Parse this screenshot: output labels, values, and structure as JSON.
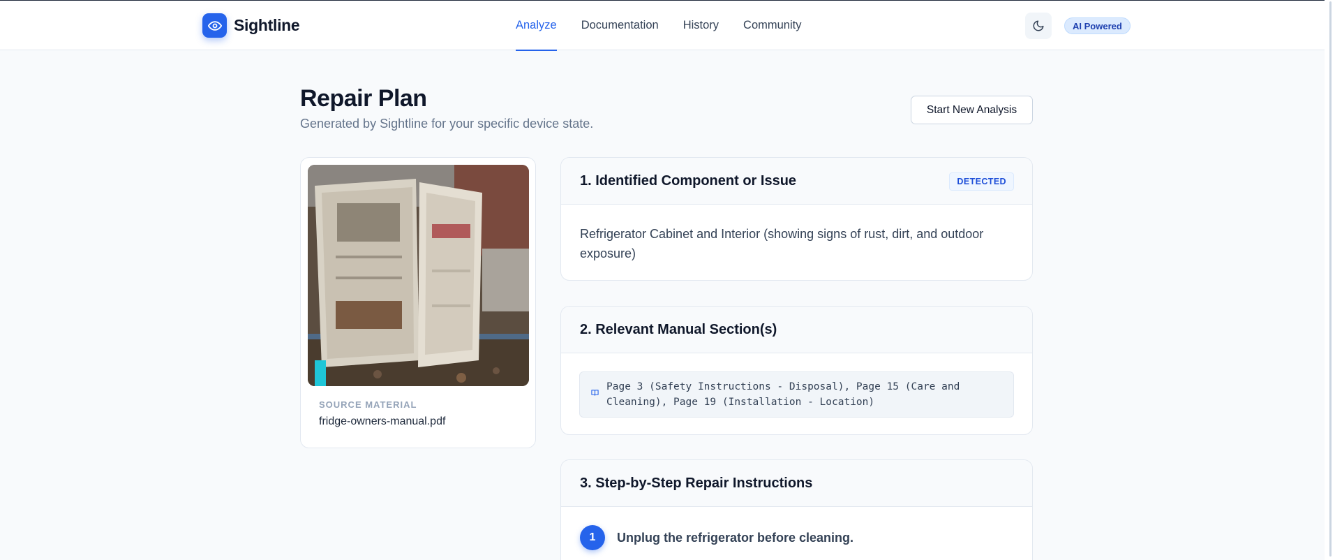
{
  "header": {
    "brand": "Sightline",
    "nav": [
      {
        "label": "Analyze",
        "active": true
      },
      {
        "label": "Documentation",
        "active": false
      },
      {
        "label": "History",
        "active": false
      },
      {
        "label": "Community",
        "active": false
      }
    ],
    "theme_icon": "moon-icon",
    "badge": "AI Powered"
  },
  "page": {
    "title": "Repair Plan",
    "subtitle": "Generated by Sightline for your specific device state.",
    "new_analysis_label": "Start New Analysis"
  },
  "source": {
    "image_alt": "Photo of rusty open refrigerator outdoors",
    "label": "SOURCE MATERIAL",
    "file": "fridge-owners-manual.pdf"
  },
  "sections": {
    "issue": {
      "title": "1. Identified Component or Issue",
      "badge": "DETECTED",
      "text": "Refrigerator Cabinet and Interior (showing signs of rust, dirt, and outdoor exposure)"
    },
    "manual": {
      "title": "2. Relevant Manual Section(s)",
      "icon": "book-icon",
      "text": "Page 3 (Safety Instructions - Disposal), Page 15 (Care and Cleaning), Page 19 (Installation - Location)"
    },
    "steps": {
      "title": "3. Step-by-Step Repair Instructions",
      "items": [
        {
          "number": "1",
          "text": "Unplug the refrigerator before cleaning."
        }
      ]
    }
  },
  "colors": {
    "accent": "#2563eb",
    "background": "#f8fafc"
  }
}
